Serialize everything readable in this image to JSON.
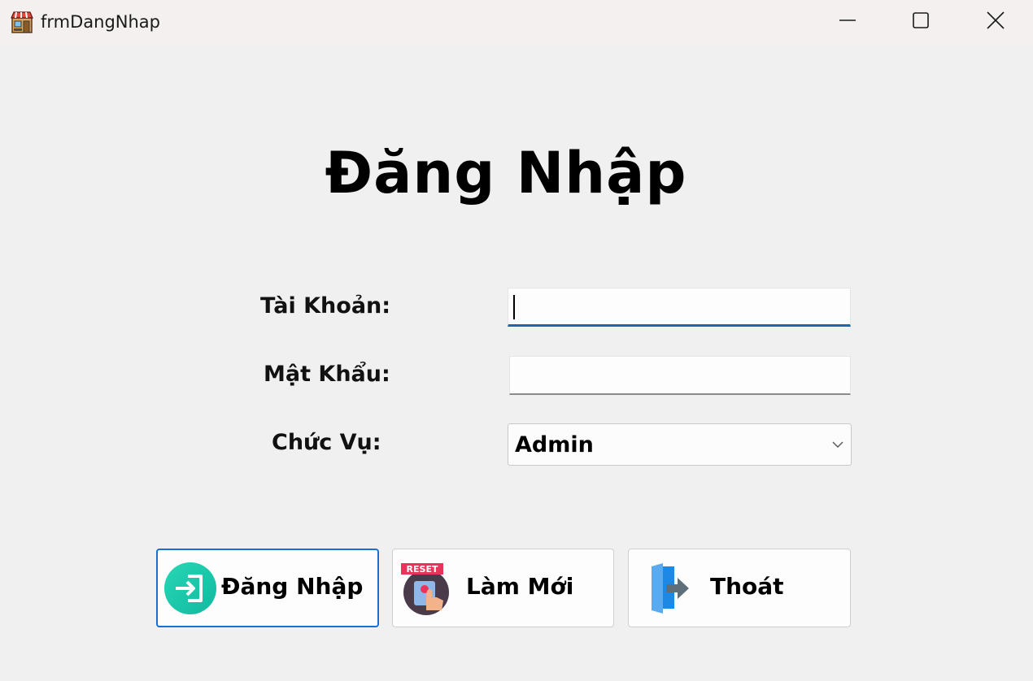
{
  "window": {
    "title": "frmDangNhap",
    "icons": {
      "app": "store-icon",
      "minimize": "minimize-icon",
      "maximize": "maximize-icon",
      "close": "close-icon"
    }
  },
  "form": {
    "heading": "Đăng Nhập",
    "username_label": "Tài Khoản:",
    "username_value": "",
    "password_label": "Mật Khẩu:",
    "password_value": "",
    "role_label": "Chức Vụ:",
    "role_selected": "Admin"
  },
  "buttons": {
    "login_label": "Đăng Nhập",
    "login_icon": "login-arrow-icon",
    "reset_label": "Làm Mới",
    "reset_icon": "reset-button-icon",
    "reset_icon_text": "RESET",
    "exit_label": "Thoát",
    "exit_icon": "exit-door-icon"
  },
  "colors": {
    "accent": "#1a67b8",
    "login_icon": "#19c9a9",
    "reset_badge": "#e8345a"
  }
}
